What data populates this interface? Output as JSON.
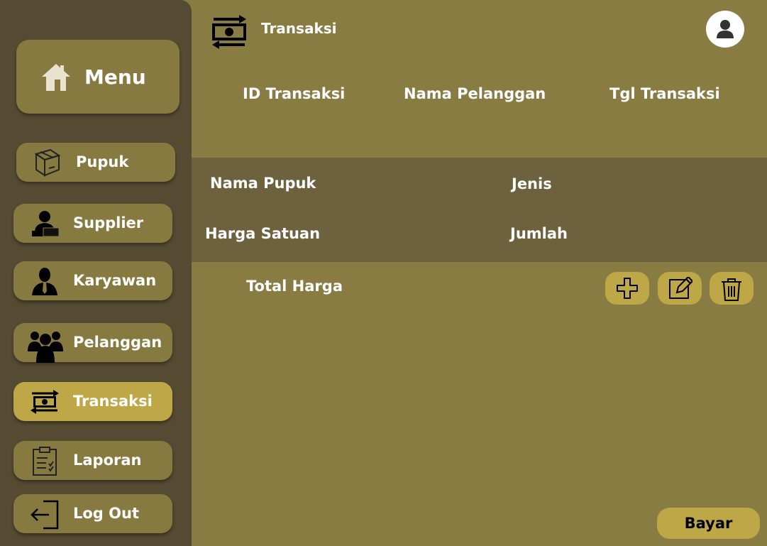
{
  "sidebar": {
    "menu": {
      "label": "Menu",
      "icon": "house-icon"
    },
    "items": [
      {
        "label": "Pupuk",
        "icon": "box-icon"
      },
      {
        "label": "Supplier",
        "icon": "supplier-icon"
      },
      {
        "label": "Karyawan",
        "icon": "employee-icon"
      },
      {
        "label": "Pelanggan",
        "icon": "customers-icon"
      },
      {
        "label": "Transaksi",
        "icon": "money-exchange-icon",
        "active": true
      },
      {
        "label": "Laporan",
        "icon": "clipboard-icon"
      },
      {
        "label": "Log Out",
        "icon": "logout-icon"
      }
    ]
  },
  "header": {
    "title": "Transaksi",
    "title_icon": "money-exchange-icon",
    "profile_icon": "user-icon"
  },
  "columns": {
    "id": "ID Transaksi",
    "customer": "Nama Pelanggan",
    "date": "Tgl Transaksi"
  },
  "detail": {
    "product": "Nama Pupuk",
    "type": "Jenis",
    "unit_price": "Harga Satuan",
    "quantity": "Jumlah"
  },
  "total_label": "Total Harga",
  "actions": [
    {
      "icon": "plus-icon"
    },
    {
      "icon": "edit-icon"
    },
    {
      "icon": "trash-icon"
    }
  ],
  "pay_button": "Bayar",
  "colors": {
    "background": "#887c42",
    "sidebar": "#554a32",
    "button": "#877a40",
    "accent": "#bda746",
    "panel": "#6e613d"
  }
}
